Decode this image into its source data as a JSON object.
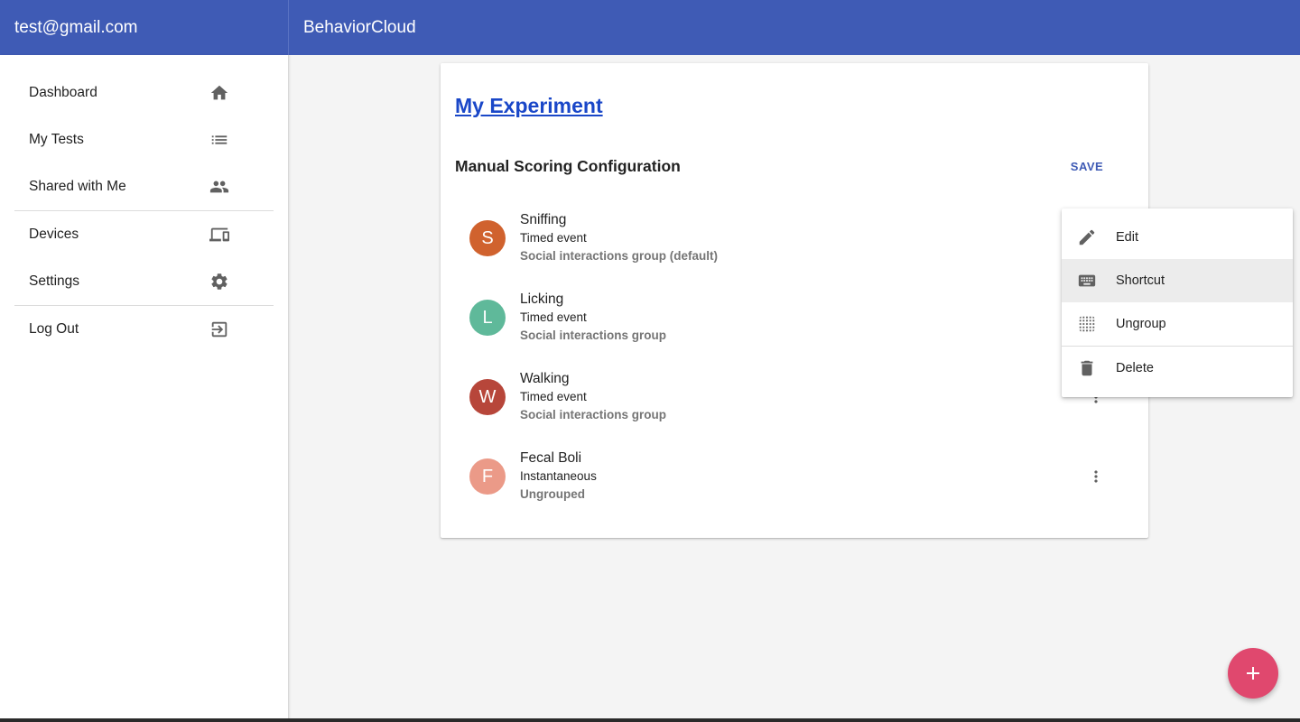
{
  "header": {
    "user_email": "test@gmail.com",
    "app_name": "BehaviorCloud"
  },
  "sidebar": {
    "items": [
      {
        "label": "Dashboard",
        "icon": "home-icon"
      },
      {
        "label": "My Tests",
        "icon": "list-icon"
      },
      {
        "label": "Shared with Me",
        "icon": "people-icon"
      },
      {
        "label": "Devices",
        "icon": "devices-icon"
      },
      {
        "label": "Settings",
        "icon": "gear-icon"
      },
      {
        "label": "Log Out",
        "icon": "logout-icon"
      }
    ]
  },
  "card": {
    "experiment_title": "My Experiment",
    "section_title": "Manual Scoring Configuration",
    "save_label": "SAVE",
    "behaviors": [
      {
        "initial": "S",
        "name": "Sniffing",
        "type": "Timed event",
        "group": "Social interactions group (default)",
        "color": "#d0622e"
      },
      {
        "initial": "L",
        "name": "Licking",
        "type": "Timed event",
        "group": "Social interactions group",
        "color": "#5fb99a"
      },
      {
        "initial": "W",
        "name": "Walking",
        "type": "Timed event",
        "group": "Social interactions group",
        "color": "#b7463a"
      },
      {
        "initial": "F",
        "name": "Fecal Boli",
        "type": "Instantaneous",
        "group": "Ungrouped",
        "color": "#eb9a88"
      }
    ]
  },
  "context_menu": {
    "items": [
      {
        "label": "Edit",
        "icon": "pencil-icon"
      },
      {
        "label": "Shortcut",
        "icon": "keyboard-icon",
        "highlighted": true
      },
      {
        "label": "Ungroup",
        "icon": "ungroup-icon"
      },
      {
        "label": "Delete",
        "icon": "trash-icon"
      }
    ]
  },
  "colors": {
    "primary": "#3f5bb5",
    "accent": "#e0486e",
    "link": "#1a47c8"
  }
}
